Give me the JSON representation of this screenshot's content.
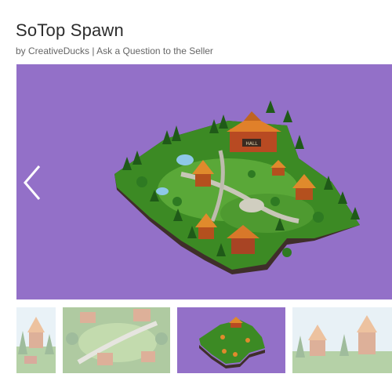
{
  "product": {
    "title": "SoTop Spawn",
    "byline_prefix": "by ",
    "author": "CreativeDucks",
    "separator": " | ",
    "ask_link": "Ask a Question to the Seller"
  },
  "gallery": {
    "background_color": "#9370c8",
    "arrow_icon": "chevron-left-icon",
    "sign_text": "HALL",
    "thumbnails": [
      {
        "name": "thumbnail-1",
        "active": false
      },
      {
        "name": "thumbnail-2",
        "active": false
      },
      {
        "name": "thumbnail-3",
        "active": true
      },
      {
        "name": "thumbnail-4",
        "active": false
      }
    ]
  }
}
